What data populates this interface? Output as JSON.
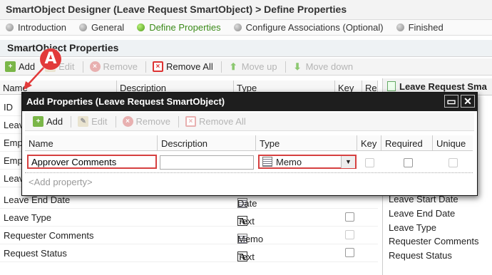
{
  "window_title": "SmartObject Designer (Leave Request SmartObject) > Define Properties",
  "steps": [
    {
      "label": "Introduction",
      "active": false
    },
    {
      "label": "General",
      "active": false
    },
    {
      "label": "Define Properties",
      "active": true
    },
    {
      "label": "Configure Associations (Optional)",
      "active": false
    },
    {
      "label": "Finished",
      "active": false
    }
  ],
  "section_title": "SmartObject Properties",
  "main_toolbar": {
    "add": "Add",
    "edit": "Edit",
    "remove": "Remove",
    "remove_all": "Remove All",
    "move_up": "Move up",
    "move_down": "Move down"
  },
  "grid": {
    "headers": {
      "name": "Name",
      "description": "Description",
      "type": "Type",
      "key": "Key",
      "required": "Re"
    },
    "rows": [
      {
        "name": "ID",
        "type": "",
        "type_icon": ""
      },
      {
        "name": "Leave",
        "type": "",
        "type_icon": ""
      },
      {
        "name": "Emp",
        "type": "",
        "type_icon": ""
      },
      {
        "name": "Emp",
        "type": "",
        "type_icon": ""
      },
      {
        "name": "Leave",
        "type": "",
        "type_icon": ""
      },
      {
        "name": "Leave End Date",
        "type": "Date",
        "type_icon": "date"
      },
      {
        "name": "Leave Type",
        "type": "Text",
        "type_icon": "text"
      },
      {
        "name": "Requester Comments",
        "type": "Memo",
        "type_icon": "memo"
      },
      {
        "name": "Request Status",
        "type": "Text",
        "type_icon": "text"
      }
    ]
  },
  "right_panel": {
    "title": "Leave Request Sma",
    "items": [
      "Leave Start Date",
      "Leave End Date",
      "Leave Type",
      "Requester Comments",
      "Request Status"
    ]
  },
  "dialog": {
    "title": "Add Properties (Leave Request SmartObject)",
    "toolbar": {
      "add": "Add",
      "edit": "Edit",
      "remove": "Remove",
      "remove_all": "Remove All"
    },
    "headers": {
      "name": "Name",
      "description": "Description",
      "type": "Type",
      "key": "Key",
      "required": "Required",
      "unique": "Unique"
    },
    "row": {
      "name_value": "Approver Comments",
      "description_value": "",
      "type_value": "Memo"
    },
    "add_placeholder": "<Add property>"
  },
  "marker_label": "A",
  "colors": {
    "highlight": "#d64040",
    "accent_green": "#4c9a16",
    "dialog_title_bg": "#1e1e1e"
  }
}
